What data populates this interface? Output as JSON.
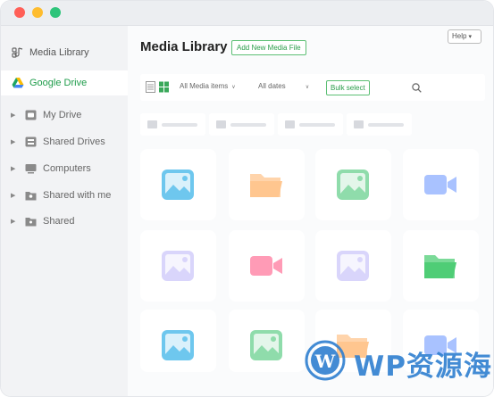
{
  "sidebar": {
    "items": [
      {
        "label": "Media Library",
        "icon": "media-library-icon"
      },
      {
        "label": "Google Drive",
        "icon": "google-drive-icon"
      }
    ],
    "sub_items": [
      {
        "label": "My Drive",
        "icon": "my-drive-icon"
      },
      {
        "label": "Shared Drives",
        "icon": "shared-drives-icon"
      },
      {
        "label": "Computers",
        "icon": "computers-icon"
      },
      {
        "label": "Shared with me",
        "icon": "shared-with-me-icon"
      },
      {
        "label": "Shared",
        "icon": "shared-folder-icon"
      }
    ]
  },
  "header": {
    "title": "Media Library",
    "add_button": "Add New Media File",
    "help_button": "Help"
  },
  "toolbar": {
    "media_filter": "All Media items",
    "date_filter": "All dates",
    "bulk_select": "Bulk select"
  },
  "grid": {
    "items": [
      {
        "type": "image-icon",
        "color": "#6ec7ee"
      },
      {
        "type": "folder-icon",
        "color": "#ffc68f"
      },
      {
        "type": "image-icon",
        "color": "#8fdcab"
      },
      {
        "type": "video-icon",
        "color": "#a9c2ff"
      },
      {
        "type": "image-icon",
        "color": "#d9d5fb"
      },
      {
        "type": "video-icon",
        "color": "#ff9bb6"
      },
      {
        "type": "image-icon",
        "color": "#d9d5fb"
      },
      {
        "type": "folder-icon",
        "color": "#4fcd76"
      },
      {
        "type": "image-icon",
        "color": "#6ec7ee"
      },
      {
        "type": "image-icon",
        "color": "#8fdcab"
      },
      {
        "type": "folder-icon",
        "color": "#ffc68f"
      },
      {
        "type": "video-icon",
        "color": "#a9c2ff"
      }
    ]
  },
  "watermark": {
    "text": "WP资源海",
    "color": "#2f7fd0"
  },
  "colors": {
    "accent": "#2a9d4a",
    "sidebar_bg": "#f2f3f5",
    "main_bg": "#fafbfc"
  }
}
